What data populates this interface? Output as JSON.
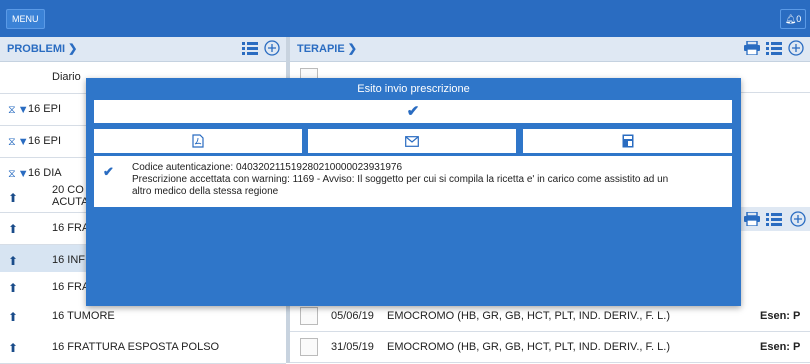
{
  "topbar": {
    "menu_label": "MENU",
    "notif_count": "0"
  },
  "problemi": {
    "title": "PROBLEMI",
    "rows": [
      {
        "label": "Diario",
        "icon": "none"
      },
      {
        "label": "16 EPI",
        "icon": "hourglass-filter"
      },
      {
        "label": "16 EPI",
        "icon": "hourglass-filter"
      },
      {
        "label": "16 DIA",
        "icon": "hourglass-filter"
      },
      {
        "label": "20 CO",
        "label2": "ACUTA",
        "icon": "house"
      },
      {
        "label": "16 FRA",
        "icon": "house"
      },
      {
        "label": "16 INF",
        "icon": "house"
      },
      {
        "label": "16 FRA",
        "icon": "house"
      },
      {
        "label": "16 TUMORE",
        "icon": "house"
      },
      {
        "label": "16 FRATTURA ESPOSTA POLSO",
        "icon": "house"
      }
    ]
  },
  "terapie": {
    "title": "TERAPIE",
    "rows": [
      {
        "date": "05/06/19",
        "desc": "EMOCROMO (HB, GR, GB, HCT, PLT, IND. DERIV., F. L.)",
        "esen": "Esen: P"
      },
      {
        "date": "31/05/19",
        "desc": "EMOCROMO (HB, GR, GB, HCT, PLT, IND. DERIV., F. L.)",
        "esen": "Esen: P"
      }
    ]
  },
  "modal": {
    "title": "Esito invio prescrizione",
    "auth_code": "Codice autenticazione: 040320211519280210000023931976",
    "warning_line1": "Prescrizione accettata con warning: 1169 - Avviso: Il soggetto per cui si compila la ricetta e' in carico come assistito ad un",
    "warning_line2": "altro medico della stessa regione"
  },
  "colors": {
    "brand": "#2a6cc1",
    "modal_bg": "#2f76c9",
    "header_bg": "#dfe8f3"
  }
}
